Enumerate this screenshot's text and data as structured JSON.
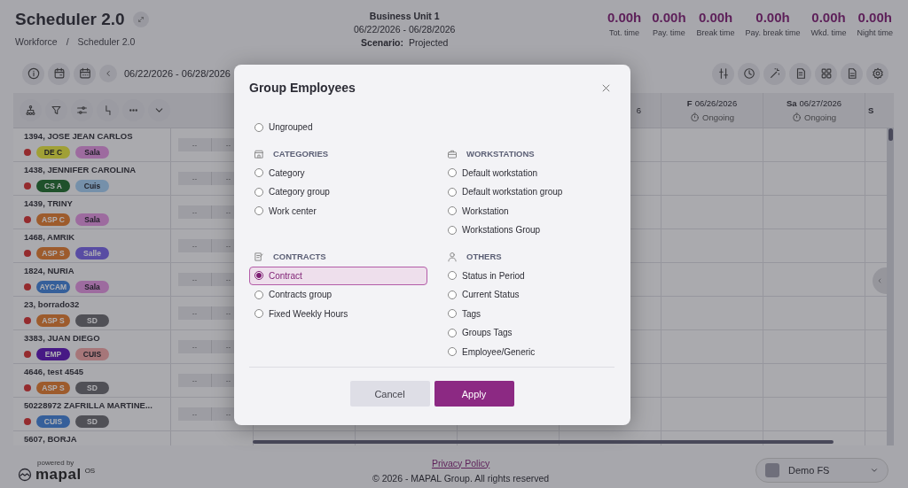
{
  "header": {
    "title": "Scheduler 2.0",
    "breadcrumb": [
      "Workforce",
      "/",
      "Scheduler 2.0"
    ],
    "business_unit": "Business Unit 1",
    "period": "06/22/2026 - 06/28/2026",
    "scenario_label": "Scenario:",
    "scenario": "Projected"
  },
  "stats": [
    {
      "value": "0.00h",
      "label": "Tot. time"
    },
    {
      "value": "0.00h",
      "label": "Pay. time"
    },
    {
      "value": "0.00h",
      "label": "Break time"
    },
    {
      "value": "0.00h",
      "label": "Pay. break time"
    },
    {
      "value": "0.00h",
      "label": "Wkd. time"
    },
    {
      "value": "0.00h",
      "label": "Night time"
    }
  ],
  "toolbar": {
    "date_range": "06/22/2026 - 06/28/2026"
  },
  "columns": [
    {
      "kind": "cut-right",
      "text": "6"
    },
    {
      "kind": "full",
      "weekday": "F",
      "date": "06/26/2026",
      "status": "Ongoing"
    },
    {
      "kind": "full",
      "weekday": "Sa",
      "date": "06/27/2026",
      "status": "Ongoing"
    },
    {
      "kind": "cut-left",
      "text": "S"
    }
  ],
  "employees": [
    {
      "name": "1394, JOSE JEAN CARLOS",
      "status_dot": {
        "color": "#942b2b"
      },
      "shifts": [
        "--",
        "--"
      ],
      "tags": [
        {
          "label": "DE C",
          "color": "#a0a033"
        },
        {
          "label": "Sala",
          "color": "#9d6b9c"
        }
      ]
    },
    {
      "name": "1438, JENNIFER CAROLINA",
      "status_dot": {
        "color": "#942b2b"
      },
      "shifts": [
        "--",
        "--"
      ],
      "tags": [
        {
          "label": "CS A",
          "color": "#1f5128"
        },
        {
          "label": "Cuis",
          "color": "#7590a7"
        }
      ]
    },
    {
      "name": "1439, TRINY",
      "status_dot": {
        "color": "#942b2b"
      },
      "shifts": [
        "--",
        "--"
      ],
      "tags": [
        {
          "label": "ASP C",
          "color": "#9d5b29"
        },
        {
          "label": "Sala",
          "color": "#9d6b9c"
        }
      ]
    },
    {
      "name": "1468, AMRIK",
      "status_dot": {
        "color": "#942b2b"
      },
      "shifts": [
        "--",
        "--"
      ],
      "tags": [
        {
          "label": "ASP S",
          "color": "#9d5b29"
        },
        {
          "label": "Salle",
          "color": "#584ca0"
        }
      ]
    },
    {
      "name": "1824, NURIA",
      "status_dot": {
        "color": "#942b2b"
      },
      "shifts": [
        "--",
        "--"
      ],
      "tags": [
        {
          "label": "AYCAM",
          "color": "#355f97"
        },
        {
          "label": "Sala",
          "color": "#9d6b9c"
        }
      ]
    },
    {
      "name": "23, borrado32",
      "status_dot": {
        "color": "#942b2b"
      },
      "shifts": [
        "--",
        "--"
      ],
      "tags": [
        {
          "label": "ASP S",
          "color": "#9d5b29"
        },
        {
          "label": "SD",
          "color": "#505053"
        }
      ]
    },
    {
      "name": "3383, JUAN DIEGO",
      "status_dot": {
        "color": "#942b2b"
      },
      "shifts": [
        "--",
        "--"
      ],
      "tags": [
        {
          "label": "EMP",
          "color": "#471982"
        },
        {
          "label": "CUIS",
          "color": "#a67676"
        }
      ]
    },
    {
      "name": "4646, test 4545",
      "status_dot": {
        "color": "#942b2b"
      },
      "shifts": [
        "--",
        "--"
      ],
      "tags": [
        {
          "label": "ASP S",
          "color": "#9d5b29"
        },
        {
          "label": "SD",
          "color": "#505053"
        }
      ]
    },
    {
      "name": "50228972 ZAFRILLA MARTINE...",
      "status_dot": {
        "color": "#942b2b"
      },
      "shifts": [
        "--",
        "--"
      ],
      "tags": [
        {
          "label": "CUIS",
          "color": "#355f97"
        },
        {
          "label": "SD",
          "color": "#505053"
        }
      ]
    },
    {
      "name": "5607, BORJA"
    }
  ],
  "footer": {
    "powered_by": "powered by",
    "brand": "mapal",
    "brand_suffix": "OS",
    "privacy_link": "Privacy Policy",
    "copyright": "© 2026 - MAPAL Group. All rights reserved",
    "account": "Demo FS"
  },
  "dialog": {
    "title": "Group Employees",
    "ungrouped": {
      "label": "Ungrouped",
      "selected": false
    },
    "sections": [
      {
        "title": "CATEGORIES",
        "options": [
          {
            "label": "Category",
            "selected": false
          },
          {
            "label": "Category group",
            "selected": false
          },
          {
            "label": "Work center",
            "selected": false
          }
        ]
      },
      {
        "title": "WORKSTATIONS",
        "options": [
          {
            "label": "Default workstation",
            "selected": false
          },
          {
            "label": "Default workstation group",
            "selected": false
          },
          {
            "label": "Workstation",
            "selected": false
          },
          {
            "label": "Workstations Group",
            "selected": false
          }
        ]
      },
      {
        "title": "CONTRACTS",
        "options": [
          {
            "label": "Contract",
            "selected": true
          },
          {
            "label": "Contracts group",
            "selected": false
          },
          {
            "label": "Fixed Weekly Hours",
            "selected": false
          }
        ]
      },
      {
        "title": "OTHERS",
        "options": [
          {
            "label": "Status in Period",
            "selected": false
          },
          {
            "label": "Current Status",
            "selected": false
          },
          {
            "label": "Tags",
            "selected": false
          },
          {
            "label": "Groups Tags",
            "selected": false
          },
          {
            "label": "Employee/Generic",
            "selected": false
          }
        ]
      }
    ],
    "buttons": {
      "cancel": "Cancel",
      "apply": "Apply"
    }
  }
}
